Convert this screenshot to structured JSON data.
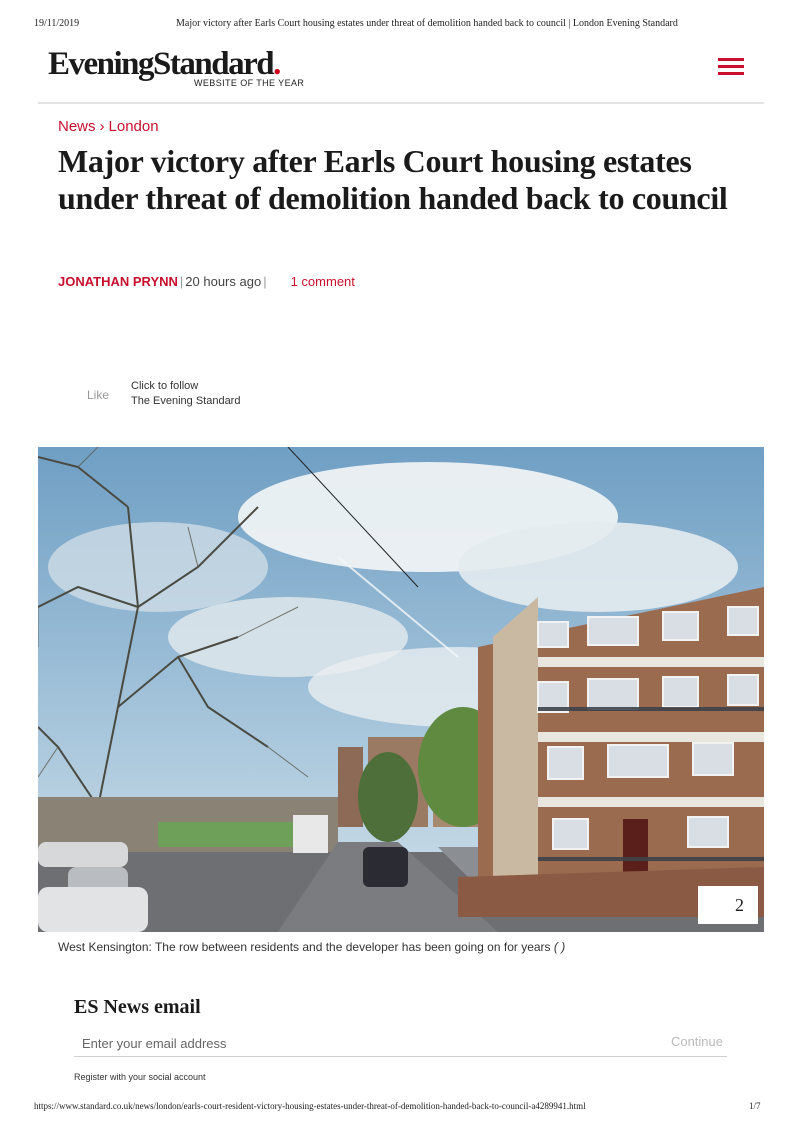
{
  "print_header": {
    "date": "19/11/2019",
    "title": "Major victory after Earls Court housing estates under threat of demolition handed back to council | London Evening Standard"
  },
  "site": {
    "logo_text": "EveningStandard",
    "logo_dot": ".",
    "tagline": "WEBSITE OF THE YEAR",
    "brand_color": "#c8102e",
    "menu_icon": "hamburger-menu-icon"
  },
  "breadcrumb": {
    "section": "News",
    "separator": "›",
    "subsection": "London"
  },
  "article": {
    "headline": "Major victory after Earls Court housing estates under threat of demolition handed back to council",
    "author": "JONATHAN PRYNN",
    "timestamp": "20 hours ago",
    "comments": "1 comment"
  },
  "social": {
    "like_label": "Like",
    "follow_line1": "Click to follow",
    "follow_line2": "The Evening Standard"
  },
  "hero": {
    "gallery_count": "2",
    "caption": "West Kensington: The row between residents and the developer has been going on for years",
    "credit": "( )"
  },
  "newsletter": {
    "title": "ES News email",
    "placeholder": "Enter your email address",
    "continue_label": "Continue",
    "register_text": "Register with your social account"
  },
  "print_footer": {
    "url": "https://www.standard.co.uk/news/london/earls-court-resident-victory-housing-estates-under-threat-of-demolition-handed-back-to-council-a4289941.html",
    "page": "1/7"
  }
}
